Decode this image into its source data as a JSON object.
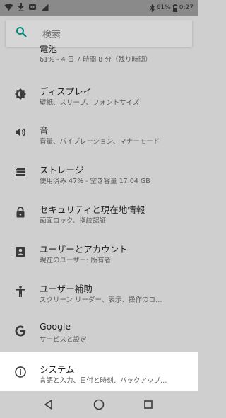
{
  "status_bar": {
    "battery_text": "61%",
    "time": "0:27"
  },
  "search": {
    "placeholder": "検索"
  },
  "items": [
    {
      "title": "電池",
      "subtitle": "61% - 4 日 7 時間 8 分（残り時間）",
      "icon": "battery-icon"
    },
    {
      "title": "ディスプレイ",
      "subtitle": "壁紙、スリープ、フォントサイズ",
      "icon": "brightness-icon"
    },
    {
      "title": "音",
      "subtitle": "音量、バイブレーション、マナーモード",
      "icon": "volume-icon"
    },
    {
      "title": "ストレージ",
      "subtitle": "使用済み 47% - 空き容量 17.04 GB",
      "icon": "storage-icon"
    },
    {
      "title": "セキュリティと現在地情報",
      "subtitle": "画面ロック、指紋認証",
      "icon": "lock-icon"
    },
    {
      "title": "ユーザーとアカウント",
      "subtitle": "現在のユーザー: 所有者",
      "icon": "account-icon"
    },
    {
      "title": "ユーザー補助",
      "subtitle": "スクリーン リーダー、表示、操作のコ…",
      "icon": "accessibility-icon"
    },
    {
      "title": "Google",
      "subtitle": "サービスと設定",
      "icon": "google-icon"
    },
    {
      "title": "システム",
      "subtitle": "言語と入力、日付と時刻、バックアップ…",
      "icon": "info-icon"
    }
  ],
  "colors": {
    "accent": "#00897b",
    "dim_background": "#cfcfcf",
    "highlight_background": "#ffffff"
  }
}
